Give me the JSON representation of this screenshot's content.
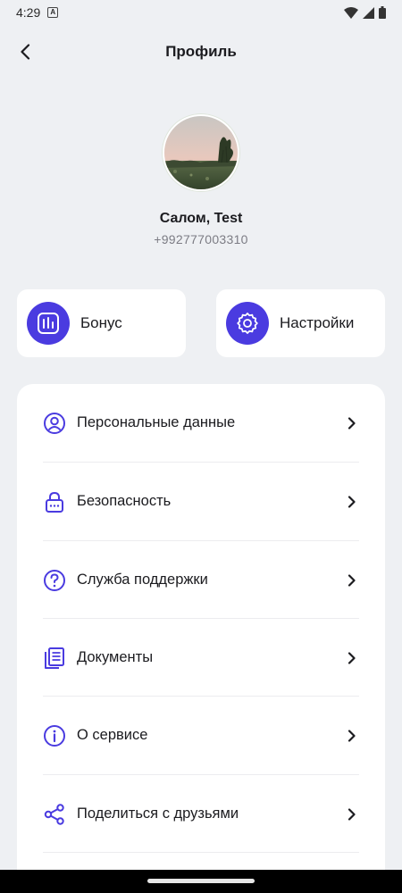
{
  "status_bar": {
    "time": "4:29"
  },
  "header": {
    "title": "Профиль"
  },
  "profile": {
    "greeting": "Салом, Test",
    "phone": "+992777003310"
  },
  "quick_actions": [
    {
      "label": "Бонус",
      "icon": "bonus-chart-icon"
    },
    {
      "label": "Настройки",
      "icon": "gear-icon"
    }
  ],
  "menu": {
    "items": [
      {
        "label": "Персональные данные",
        "icon": "user-circle-icon"
      },
      {
        "label": "Безопасность",
        "icon": "lock-icon"
      },
      {
        "label": "Служба поддержки",
        "icon": "question-circle-icon"
      },
      {
        "label": "Документы",
        "icon": "documents-icon"
      },
      {
        "label": "О сервисе",
        "icon": "info-circle-icon"
      },
      {
        "label": "Поделиться с друзьями",
        "icon": "share-icon"
      }
    ]
  },
  "colors": {
    "accent": "#4a3be0",
    "background": "#eef0f3",
    "card": "#ffffff"
  }
}
